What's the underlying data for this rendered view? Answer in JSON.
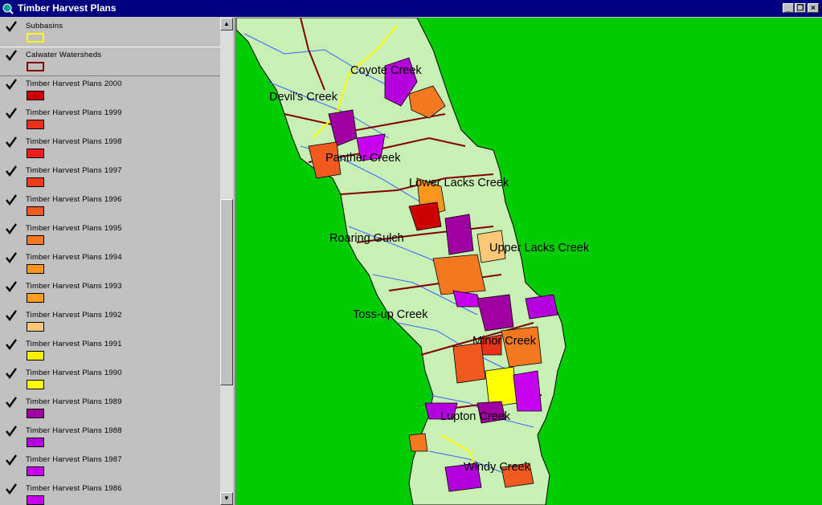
{
  "window": {
    "title": "Timber Harvest Plans",
    "min_glyph": "_",
    "restore_glyph": "❐",
    "close_glyph": "×"
  },
  "scrollbar": {
    "up_glyph": "▲",
    "down_glyph": "▼"
  },
  "legend": [
    {
      "label": "Subbasins",
      "fill": "none",
      "border": "#ffff00",
      "checked": true
    },
    {
      "label": "Calwater Watersheds",
      "fill": "none",
      "border": "#800000",
      "checked": true
    },
    {
      "label": "Timber Harvest Plans 2000",
      "fill": "#cc0000",
      "checked": true
    },
    {
      "label": "Timber Harvest Plans 1999",
      "fill": "#e8321c",
      "checked": true
    },
    {
      "label": "Timber Harvest Plans 1998",
      "fill": "#ee1c1c",
      "checked": true
    },
    {
      "label": "Timber Harvest Plans 1997",
      "fill": "#f03c1a",
      "checked": true
    },
    {
      "label": "Timber Harvest Plans 1996",
      "fill": "#f05a1e",
      "checked": true
    },
    {
      "label": "Timber Harvest Plans 1995",
      "fill": "#f47820",
      "checked": true
    },
    {
      "label": "Timber Harvest Plans 1994",
      "fill": "#f8961e",
      "checked": true
    },
    {
      "label": "Timber Harvest Plans 1993",
      "fill": "#faa01e",
      "checked": true
    },
    {
      "label": "Timber Harvest Plans 1992",
      "fill": "#fcc878",
      "checked": true
    },
    {
      "label": "Timber Harvest Plans 1991",
      "fill": "#f0f000",
      "checked": true
    },
    {
      "label": "Timber Harvest Plans 1990",
      "fill": "#ffff00",
      "checked": true
    },
    {
      "label": "Timber Harvest Plans 1989",
      "fill": "#a000a0",
      "checked": true
    },
    {
      "label": "Timber Harvest Plans 1988",
      "fill": "#b400dc",
      "checked": true
    },
    {
      "label": "Timber Harvest Plans 1987",
      "fill": "#c800f0",
      "checked": true
    },
    {
      "label": "Timber Harvest Plans 1986",
      "fill": "#c800f0",
      "checked": true
    }
  ],
  "map": {
    "background": "#00cc00",
    "land_color": "#c8f0b4",
    "labels": [
      "Coyote Creek",
      "Devil's Creek",
      "Panther Creek",
      "Lower Lacks Creek",
      "Roaring Gulch",
      "Upper Lacks Creek",
      "Toss-up Creek",
      "Minor Creek",
      "Lupton Creek",
      "Windy Creek"
    ]
  }
}
